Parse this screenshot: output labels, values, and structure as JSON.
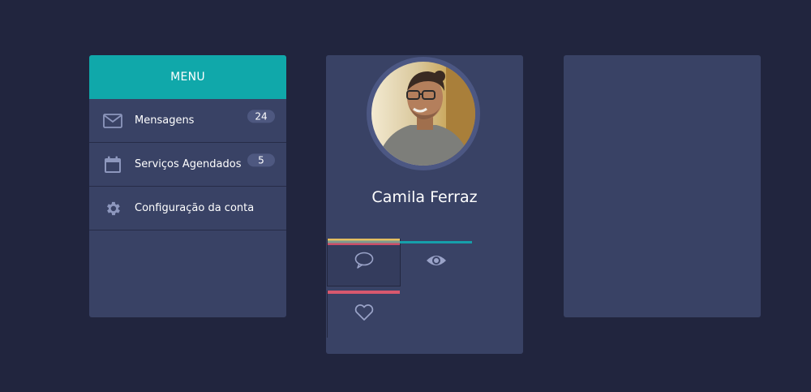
{
  "menu": {
    "title": "MENU",
    "items": [
      {
        "label": "Mensagens",
        "icon": "envelope-icon",
        "badge": "24"
      },
      {
        "label": "Serviços Agendados",
        "icon": "calendar-icon",
        "badge": "5"
      },
      {
        "label": "Configuração da conta",
        "icon": "gear-icon",
        "badge": null
      }
    ]
  },
  "profile": {
    "name": "Camila Ferraz",
    "avatar": "profile-photo",
    "tabs": [
      {
        "icon": "comment-icon"
      },
      {
        "icon": "eye-icon"
      },
      {
        "icon": "heart-icon"
      }
    ]
  },
  "colors": {
    "background": "#21253e",
    "panel": "#394265",
    "accent": "#10a8aa",
    "badge": "#4e5880",
    "bar_yellow": "#e4be60",
    "bar_red": "#d8586e",
    "bar_teal": "#169faa"
  }
}
